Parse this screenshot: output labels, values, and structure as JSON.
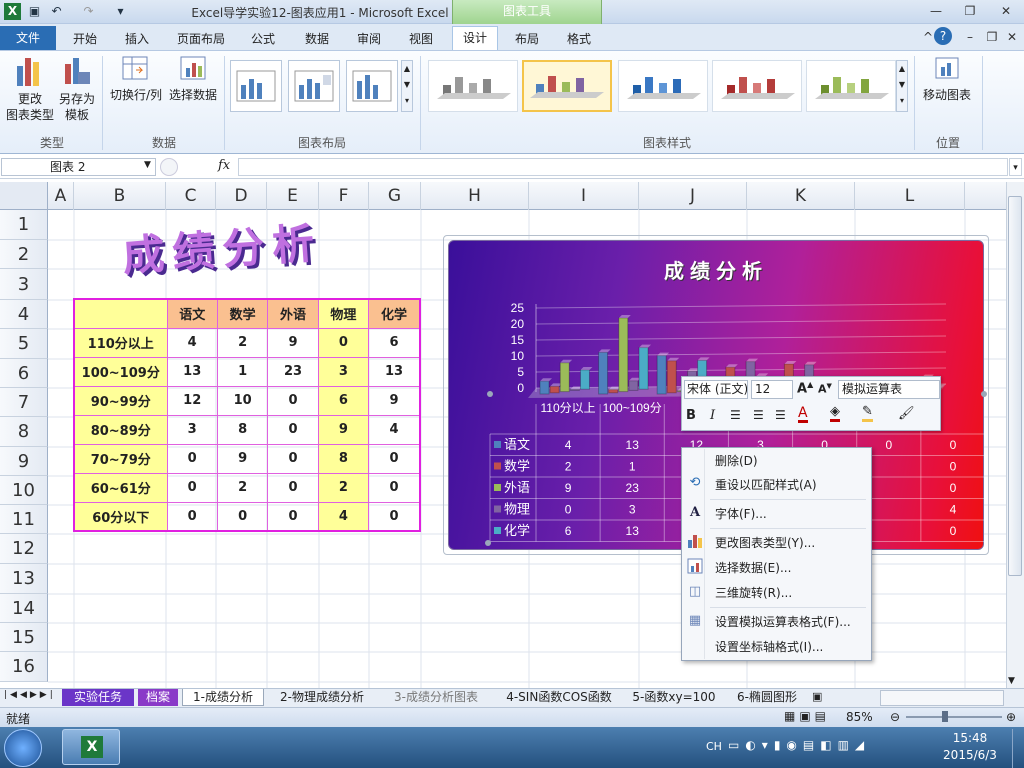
{
  "window": {
    "title": "Excel导学实验12-图表应用1 - Microsoft Excel",
    "context_tab": "图表工具"
  },
  "tabs": [
    "文件",
    "开始",
    "插入",
    "页面布局",
    "公式",
    "数据",
    "审阅",
    "视图",
    "设计",
    "布局",
    "格式"
  ],
  "ribbon": {
    "change_type_l1": "更改",
    "change_type_l2": "图表类型",
    "save_template_l1": "另存为",
    "save_template_l2": "模板",
    "switch_rowcol": "切换行/列",
    "select_data": "选择数据",
    "move_chart": "移动图表",
    "groups": {
      "type": "类型",
      "data": "数据",
      "layout": "图表布局",
      "styles": "图表样式",
      "location": "位置"
    }
  },
  "formula_bar": {
    "name_box": "图表 2",
    "fx": "fx"
  },
  "columns": [
    "A",
    "B",
    "C",
    "D",
    "E",
    "F",
    "G",
    "H",
    "I",
    "J",
    "K",
    "L"
  ],
  "rows": [
    "1",
    "2",
    "3",
    "4",
    "5",
    "6",
    "7",
    "8",
    "9",
    "10",
    "11",
    "12",
    "13",
    "14",
    "15",
    "16"
  ],
  "sheet_title": "成绩分析",
  "table": {
    "headers": [
      "语文",
      "数学",
      "外语",
      "物理",
      "化学"
    ],
    "row_labels": [
      "110分以上",
      "100~109分",
      "90~99分",
      "80~89分",
      "70~79分",
      "60~61分",
      "60分以下"
    ],
    "values": [
      [
        4,
        2,
        9,
        0,
        6
      ],
      [
        13,
        1,
        23,
        3,
        13
      ],
      [
        12,
        10,
        0,
        6,
        9
      ],
      [
        3,
        8,
        0,
        9,
        4
      ],
      [
        0,
        9,
        0,
        8,
        0
      ],
      [
        0,
        2,
        0,
        2,
        0
      ],
      [
        0,
        0,
        0,
        4,
        0
      ]
    ]
  },
  "chart_data": {
    "type": "bar",
    "title": "成绩分析",
    "categories": [
      "110分以上",
      "100~109分",
      "90~99分",
      "80~89分",
      "70~79分",
      "60~61分",
      "60分以下"
    ],
    "series": [
      {
        "name": "语文",
        "values": [
          4,
          13,
          12,
          3,
          0,
          0,
          0
        ],
        "color": "#4f81bd"
      },
      {
        "name": "数学",
        "values": [
          2,
          1,
          10,
          8,
          9,
          2,
          0
        ],
        "color": "#c0504d"
      },
      {
        "name": "外语",
        "values": [
          9,
          23,
          0,
          0,
          0,
          0,
          0
        ],
        "color": "#9bbb59"
      },
      {
        "name": "物理",
        "values": [
          0,
          3,
          6,
          9,
          8,
          2,
          4
        ],
        "color": "#8064a2"
      },
      {
        "name": "化学",
        "values": [
          6,
          13,
          9,
          4,
          0,
          0,
          0
        ],
        "color": "#4bacc6"
      }
    ],
    "yticks": [
      "0",
      "5",
      "10",
      "15",
      "20",
      "25"
    ],
    "ylim": [
      0,
      25
    ],
    "visible_cat_labels": [
      "110分以上",
      "100~109分",
      "90~"
    ],
    "datatable_visible": [
      [
        "4",
        "13",
        "12",
        "3",
        "0",
        "0",
        "0"
      ],
      [
        "2",
        "1",
        "10",
        "",
        "",
        "",
        "0"
      ],
      [
        "9",
        "23",
        "",
        "",
        "",
        "",
        "0"
      ],
      [
        "0",
        "3",
        "6",
        "",
        "",
        "",
        "4"
      ],
      [
        "6",
        "13",
        "9",
        "",
        "",
        "",
        "0"
      ]
    ]
  },
  "minibar": {
    "font": "宋体 (正文)",
    "size": "12",
    "element": "模拟运算表"
  },
  "context_menu": [
    "删除(D)",
    "重设以匹配样式(A)",
    "字体(F)...",
    "更改图表类型(Y)...",
    "选择数据(E)...",
    "三维旋转(R)...",
    "设置模拟运算表格式(F)...",
    "设置坐标轴格式(I)..."
  ],
  "sheets": [
    "实验任务",
    "档案",
    "1-成绩分析",
    "2-物理成绩分析",
    "3-成绩分析图表",
    "4-SIN函数COS函数",
    "5-函数xy=100",
    "6-椭圆图形"
  ],
  "status": {
    "ready": "就绪",
    "zoom": "85%"
  },
  "taskbar": {
    "lang": "CH",
    "time": "15:48",
    "date": "2015/6/3"
  }
}
